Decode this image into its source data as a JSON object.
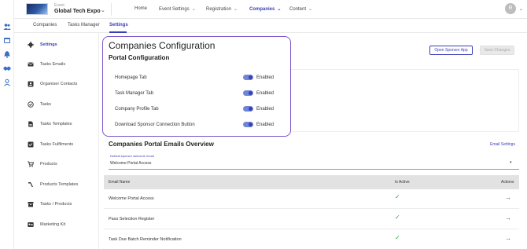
{
  "rail": {
    "icons": [
      "users-icon",
      "calendar-icon",
      "bell-icon",
      "handshake-icon",
      "person-badge-icon"
    ]
  },
  "header": {
    "event_label": "Event",
    "event_name": "Global Tech Expo",
    "nav": [
      {
        "label": "Home",
        "has_caret": false
      },
      {
        "label": "Event Settings",
        "has_caret": true
      },
      {
        "label": "Registration",
        "has_caret": true
      },
      {
        "label": "Companies",
        "has_caret": true,
        "active": true
      },
      {
        "label": "Content",
        "has_caret": true
      }
    ],
    "avatar_initial": "R"
  },
  "tabs": [
    {
      "label": "Companies"
    },
    {
      "label": "Tasks Manager"
    },
    {
      "label": "Settings",
      "active": true
    }
  ],
  "sidebar": {
    "items": [
      {
        "label": "Settings",
        "icon": "gear-icon",
        "active": true
      },
      {
        "label": "Tasks Emails",
        "icon": "envelope-icon"
      },
      {
        "label": "Organiser Contacts",
        "icon": "contact-card-icon"
      },
      {
        "label": "Tasks",
        "icon": "task-check-icon"
      },
      {
        "label": "Tasks Templates",
        "icon": "document-icon"
      },
      {
        "label": "Tasks Fulfilments",
        "icon": "checkbox-icon"
      },
      {
        "label": "Products",
        "icon": "cart-icon"
      },
      {
        "label": "Products Templates",
        "icon": "stamp-icon"
      },
      {
        "label": "Tasks / Products",
        "icon": "box-icon"
      },
      {
        "label": "Marketing Kit",
        "icon": "id-card-icon"
      }
    ]
  },
  "main": {
    "open_sponsor_app_label": "Open Sponsor App",
    "save_changes_label": "Save Changes",
    "config_title": "Companies Configuration",
    "portal_title": "Portal Configuration",
    "config_rows": [
      {
        "label": "Homepage Tab",
        "status": "Enabled",
        "enabled": true
      },
      {
        "label": "Task Manager Tab",
        "status": "Enabled",
        "enabled": true
      },
      {
        "label": "Company Profile Tab",
        "status": "Enabled",
        "enabled": true
      },
      {
        "label": "Download Sponsor Connection Button",
        "status": "Enabled",
        "enabled": true
      }
    ],
    "emails_title": "Companies Portal Emails Overview",
    "email_settings_label": "Email Settings",
    "select": {
      "label": "Default sponsor welcome email",
      "value": "Welcome Portal Access"
    },
    "table": {
      "headers": {
        "name": "Email Name",
        "active": "Is Active",
        "actions": "Actions"
      },
      "rows": [
        {
          "name": "Welcome Portal Access",
          "active": true
        },
        {
          "name": "Pass Selection Register",
          "active": true
        },
        {
          "name": "Task Due Batch Reminder Notification",
          "active": true
        }
      ]
    }
  },
  "colors": {
    "accent": "#3b3fb6",
    "highlight_border": "#7d56c9",
    "check": "#2e9e44"
  }
}
